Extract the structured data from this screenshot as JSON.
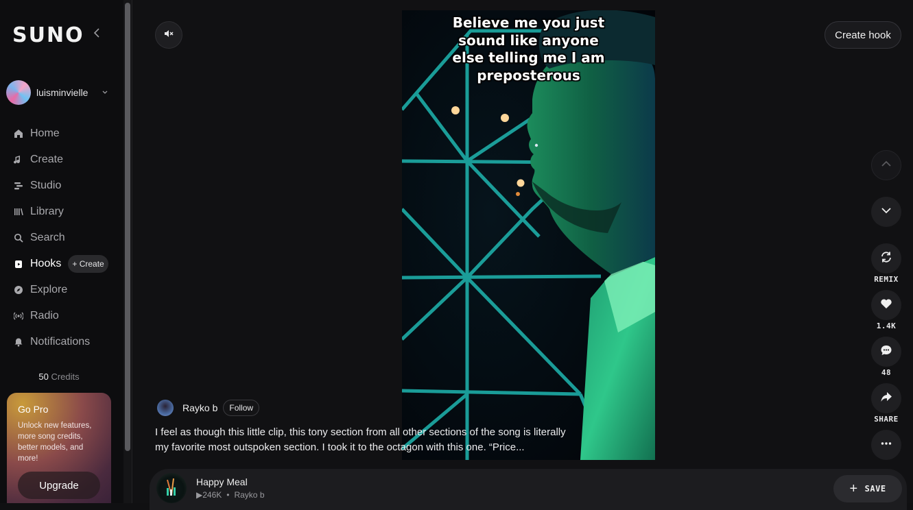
{
  "sidebar": {
    "logo": "SUNO",
    "username": "luisminvielle",
    "nav": [
      {
        "label": "Home",
        "icon": "home-icon"
      },
      {
        "label": "Create",
        "icon": "music-note-icon"
      },
      {
        "label": "Studio",
        "icon": "studio-icon"
      },
      {
        "label": "Library",
        "icon": "library-icon"
      },
      {
        "label": "Search",
        "icon": "search-icon"
      },
      {
        "label": "Hooks",
        "icon": "hooks-icon",
        "active": true
      },
      {
        "label": "Explore",
        "icon": "compass-icon"
      },
      {
        "label": "Radio",
        "icon": "radio-icon"
      },
      {
        "label": "Notifications",
        "icon": "bell-icon"
      }
    ],
    "hooks_create_label": "+ Create",
    "credits_value": "50",
    "credits_label": "Credits",
    "promo": {
      "title": "Go Pro",
      "body": "Unlock new features, more song credits, better models, and more!",
      "button": "Upgrade"
    }
  },
  "header": {
    "create_hook_label": "Create hook"
  },
  "video": {
    "caption": "Believe me you just sound like anyone else telling me I am preposterous"
  },
  "actions": {
    "remix_label": "REMIX",
    "likes": "1.4K",
    "comments": "48",
    "share_label": "SHARE"
  },
  "post": {
    "author": "Rayko b",
    "follow_label": "Follow",
    "description": "I feel as though this little clip, this tony section from all other sections of the song is literally my favorite most outspoken section. I took it to the octagon with this one. “Price..."
  },
  "player": {
    "title": "Happy Meal",
    "plays": "246K",
    "artist": "Rayko b",
    "save_label": "SAVE"
  },
  "colors": {
    "background": "#111113",
    "sidebar": "#0d0d0f",
    "accent_green": "#19d47a"
  }
}
